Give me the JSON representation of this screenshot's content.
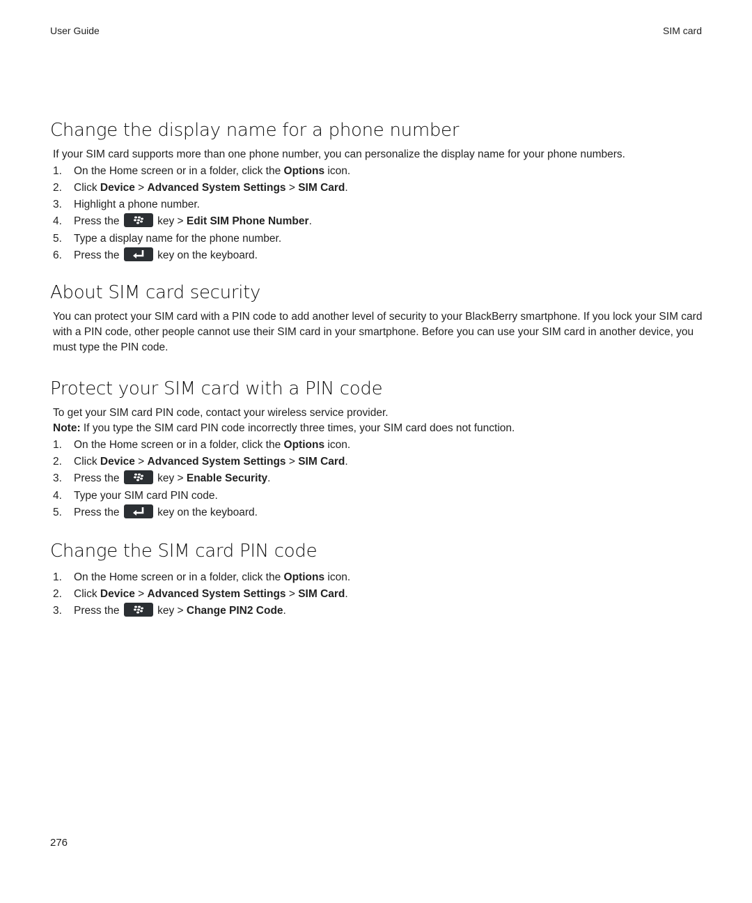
{
  "header": {
    "left": "User Guide",
    "right": "SIM card"
  },
  "sections": [
    {
      "title": "Change the display name for a phone number",
      "intro": "If your SIM card supports more than one phone number, you can personalize the display name for your phone numbers.",
      "steps": [
        {
          "num": "1.",
          "pre": "On the Home screen or in a folder, click the ",
          "b1": "Options",
          "post": " icon."
        },
        {
          "num": "2.",
          "pre": "Click ",
          "b1": "Device",
          "sep1": " > ",
          "b2": "Advanced System Settings",
          "sep2": " > ",
          "b3": "SIM Card",
          "post": "."
        },
        {
          "num": "3.",
          "text": "Highlight a phone number."
        },
        {
          "num": "4.",
          "pre": "Press the ",
          "key": "menu-key-icon",
          "mid": " key > ",
          "b1": "Edit SIM Phone Number",
          "post": "."
        },
        {
          "num": "5.",
          "text": "Type a display name for the phone number."
        },
        {
          "num": "6.",
          "pre": "Press the ",
          "key": "enter-key-icon",
          "mid": " key on the keyboard."
        }
      ]
    },
    {
      "title": "About SIM card security",
      "intro": "You can protect your SIM card with a PIN code to add another level of security to your BlackBerry smartphone. If you lock your SIM card with a PIN code, other people cannot use their SIM card in your smartphone. Before you can use your SIM card in another device, you must type the PIN code."
    },
    {
      "title": "Protect your SIM card with a PIN code",
      "intro": "To get your SIM card PIN code, contact your wireless service provider.",
      "note_label": "Note:",
      "note_text": " If you type the SIM card PIN code incorrectly three times, your SIM card does not function.",
      "steps": [
        {
          "num": "1.",
          "pre": "On the Home screen or in a folder, click the ",
          "b1": "Options",
          "post": " icon."
        },
        {
          "num": "2.",
          "pre": "Click ",
          "b1": "Device",
          "sep1": " > ",
          "b2": "Advanced System Settings",
          "sep2": " > ",
          "b3": "SIM Card",
          "post": "."
        },
        {
          "num": "3.",
          "pre": "Press the ",
          "key": "menu-key-icon",
          "mid": " key > ",
          "b1": "Enable Security",
          "post": "."
        },
        {
          "num": "4.",
          "text": "Type your SIM card PIN code."
        },
        {
          "num": "5.",
          "pre": "Press the ",
          "key": "enter-key-icon",
          "mid": " key on the keyboard."
        }
      ]
    },
    {
      "title": "Change the SIM card PIN code",
      "steps": [
        {
          "num": "1.",
          "pre": "On the Home screen or in a folder, click the ",
          "b1": "Options",
          "post": " icon."
        },
        {
          "num": "2.",
          "pre": "Click ",
          "b1": "Device",
          "sep1": " > ",
          "b2": "Advanced System Settings",
          "sep2": " > ",
          "b3": "SIM Card",
          "post": "."
        },
        {
          "num": "3.",
          "pre": "Press the ",
          "key": "menu-key-icon",
          "mid": " key > ",
          "b1": "Change PIN2 Code",
          "post": "."
        }
      ]
    }
  ],
  "footer": {
    "page_number": "276"
  }
}
